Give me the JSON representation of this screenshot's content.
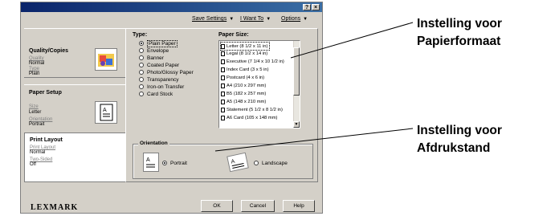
{
  "window": {
    "help_glyph": "?",
    "close_glyph": "×",
    "menus": [
      {
        "label": "Save Settings",
        "icon": "chevron-down-icon"
      },
      {
        "label": "I Want To",
        "icon": "chevron-down-icon"
      },
      {
        "label": "Options",
        "icon": "chevron-down-icon"
      }
    ]
  },
  "sidebar": {
    "sections": [
      {
        "title": "Quality/Copies",
        "fields": [
          {
            "label": "Quality",
            "value": "Normal"
          },
          {
            "label": "Type",
            "value": "Plain"
          }
        ]
      },
      {
        "title": "Paper Setup",
        "fields": [
          {
            "label": "Size",
            "value": "Letter"
          },
          {
            "label": "Orientation",
            "value": "Portrait"
          }
        ]
      },
      {
        "title": "Print Layout",
        "fields": [
          {
            "label": "Print Layout",
            "value": "Normal"
          },
          {
            "label": "Two-Sided",
            "value": "Off"
          }
        ]
      }
    ]
  },
  "paper_type": {
    "label": "Type:",
    "options": [
      "Plain Paper",
      "Envelope",
      "Banner",
      "Coated Paper",
      "Photo/Glossy Paper",
      "Transparency",
      "Iron-on Transfer",
      "Card Stock"
    ],
    "selected": "Plain Paper"
  },
  "paper_size": {
    "label": "Paper Size:",
    "options": [
      "Letter (8 1/2 x 11 in)",
      "Legal (8 1/2 x 14 in)",
      "Executive (7 1/4 x 10 1/2 in)",
      "Index Card (3 x 5 in)",
      "Postcard (4 x 6 in)",
      "A4 (210 x 297 mm)",
      "B5 (182 x 257 mm)",
      "A5 (148 x 210 mm)",
      "Statement (5 1/2 x 8 1/2 in)",
      "A6 Card (105 x 148 mm)"
    ],
    "selected": "Letter (8 1/2 x 11 in)"
  },
  "orientation": {
    "title": "Orientation",
    "options": [
      "Portrait",
      "Landscape"
    ],
    "selected": "Portrait"
  },
  "footer": {
    "logo": "LEXMARK",
    "buttons": [
      "OK",
      "Cancel",
      "Help"
    ]
  },
  "annotations": {
    "paper_size_line1": "Instelling voor",
    "paper_size_line2": "Papierformaat",
    "orientation_line1": "Instelling voor",
    "orientation_line2": "Afdrukstand"
  },
  "colors": {
    "titlebar": "#0a246a",
    "dialog": "#d4d0c8"
  }
}
